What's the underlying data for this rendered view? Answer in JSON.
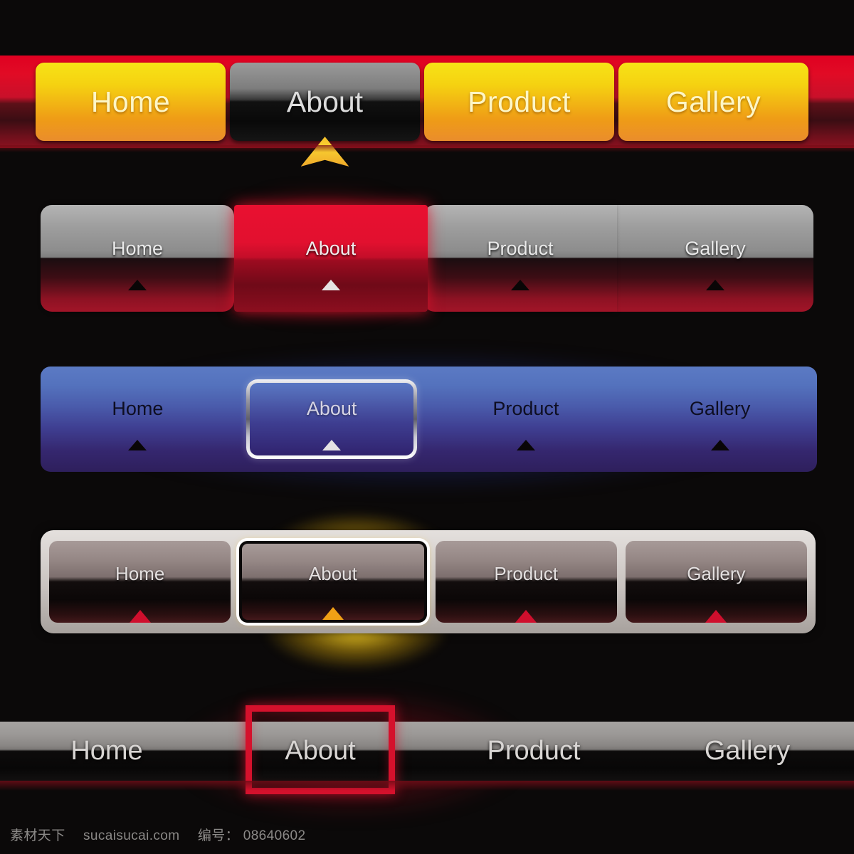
{
  "page": {
    "background": "#0b0909",
    "watermark": {
      "brand": "素材天下",
      "site": "sucaisucai.com",
      "id_label": "编号：",
      "id_value": "08640602"
    }
  },
  "menus": [
    {
      "id": "yellow-red-bar",
      "style": "yellow-buttons-on-red",
      "bar_color": "#e00021",
      "accent_color": "#f5d211",
      "selected": "About",
      "indicator": "up-arrow-yellow",
      "items": [
        {
          "label": "Home",
          "state": "normal"
        },
        {
          "label": "About",
          "state": "selected"
        },
        {
          "label": "Product",
          "state": "normal"
        },
        {
          "label": "Gallery",
          "state": "normal"
        }
      ]
    },
    {
      "id": "red-gray-bar",
      "style": "gray-to-red-gradient-buttons",
      "bar_color": "#a21428",
      "accent_color": "#e91030",
      "selected": "About",
      "indicator": "up-triangle",
      "items": [
        {
          "label": "Home",
          "state": "normal"
        },
        {
          "label": "About",
          "state": "selected"
        },
        {
          "label": "Product",
          "state": "normal"
        },
        {
          "label": "Gallery",
          "state": "normal"
        }
      ]
    },
    {
      "id": "blue-bar",
      "style": "blue-to-purple-gradient-bar",
      "bar_color": "#5b7ac4",
      "accent_color": "#2e1f5c",
      "selected": "About",
      "indicator": "up-triangle",
      "items": [
        {
          "label": "Home",
          "state": "normal"
        },
        {
          "label": "About",
          "state": "selected"
        },
        {
          "label": "Product",
          "state": "normal"
        },
        {
          "label": "Gallery",
          "state": "normal"
        }
      ]
    },
    {
      "id": "silver-bar",
      "style": "silver-frame-dark-buttons",
      "bar_color": "#d8d3d0",
      "accent_color": "#f0a015",
      "selected": "About",
      "indicator": "up-triangle",
      "items": [
        {
          "label": "Home",
          "state": "normal"
        },
        {
          "label": "About",
          "state": "selected"
        },
        {
          "label": "Product",
          "state": "normal"
        },
        {
          "label": "Gallery",
          "state": "normal"
        }
      ]
    },
    {
      "id": "flat-gray-bar",
      "style": "flat-gray-black-split-bar",
      "bar_color": "#8a8785",
      "accent_color": "#d4112c",
      "selected": "About",
      "indicator": "red-rectangle-outline",
      "items": [
        {
          "label": "Home",
          "state": "normal"
        },
        {
          "label": "About",
          "state": "selected"
        },
        {
          "label": "Product",
          "state": "normal"
        },
        {
          "label": "Gallery",
          "state": "normal"
        }
      ]
    }
  ]
}
